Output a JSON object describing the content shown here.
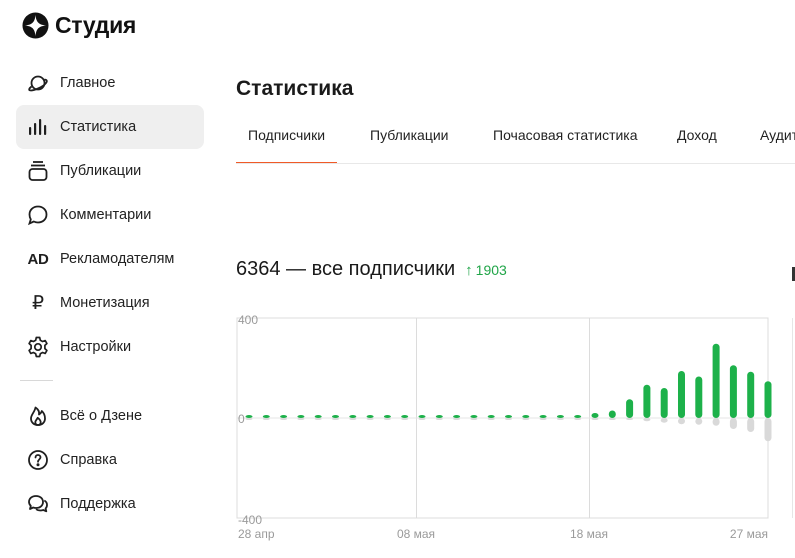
{
  "app": {
    "title": "Студия"
  },
  "sidebar": {
    "items": [
      {
        "label": "Главное",
        "icon": "planet-icon"
      },
      {
        "label": "Статистика",
        "icon": "bar-chart-icon",
        "active": true
      },
      {
        "label": "Публикации",
        "icon": "stack-icon"
      },
      {
        "label": "Комментарии",
        "icon": "comment-icon"
      },
      {
        "label": "Рекламодателям",
        "icon": "ad-icon",
        "glyph": "AD"
      },
      {
        "label": "Монетизация",
        "icon": "ruble-icon",
        "glyph": "₽"
      },
      {
        "label": "Настройки",
        "icon": "gear-icon"
      }
    ],
    "bottom_items": [
      {
        "label": "Всё о Дзене",
        "icon": "flame-icon"
      },
      {
        "label": "Справка",
        "icon": "help-icon"
      },
      {
        "label": "Поддержка",
        "icon": "support-chat-icon"
      }
    ]
  },
  "main": {
    "title": "Статистика",
    "tabs": [
      {
        "label": "Подписчики",
        "active": true
      },
      {
        "label": "Публикации"
      },
      {
        "label": "Почасовая статистика"
      },
      {
        "label": "Доход"
      },
      {
        "label": "Аудит"
      }
    ],
    "summary": {
      "total": "6364 — все подписчики",
      "delta": "1903",
      "delta_color": "#20a548"
    }
  },
  "colors": {
    "accent": "#f05a28",
    "positive": "#1db14a",
    "negative": "#d9d9d9",
    "active_bg": "#efefef"
  },
  "chart_data": {
    "type": "bar",
    "ylim": [
      -400,
      400
    ],
    "y_ticks": [
      "400",
      "0",
      "-400"
    ],
    "x_ticks": [
      "28 апр",
      "08 мая",
      "18 мая",
      "27 мая"
    ],
    "grid": true,
    "series": [
      {
        "values": [
          5,
          5,
          5,
          5,
          5,
          5,
          5,
          5,
          5,
          5,
          5,
          5,
          5,
          5,
          5,
          5,
          5,
          5,
          5,
          10,
          20,
          30,
          75,
          133,
          120,
          188,
          166,
          297,
          211,
          185,
          147
        ]
      },
      {
        "values": [
          -1,
          -1,
          -1,
          -1,
          -1,
          -1,
          -1,
          -1,
          -1,
          -1,
          -1,
          -1,
          -1,
          -1,
          -1,
          -1,
          -1,
          -1,
          -1,
          -1,
          -5,
          -6,
          -8,
          -13,
          -19,
          -25,
          -27,
          -31,
          -44,
          -56,
          -93
        ]
      }
    ]
  }
}
